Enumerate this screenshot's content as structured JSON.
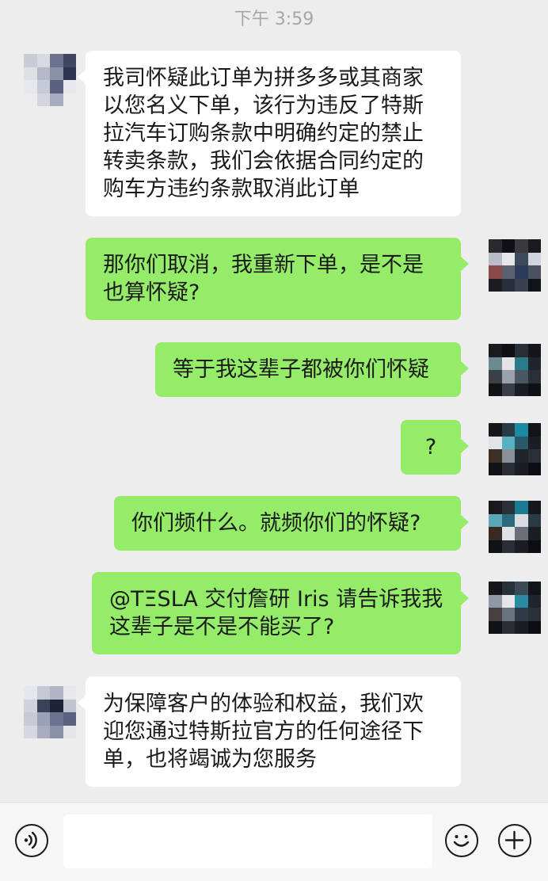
{
  "status": {
    "time": "下午 3:59"
  },
  "messages": [
    {
      "side": "in",
      "text": "我司怀疑此订单为拼多多或其商家以您名义下单，该行为违反了特斯拉汽车订购条款中明确约定的禁止转卖条款，我们会依据合同约定的购车方违约条款取消此订单"
    },
    {
      "side": "out",
      "text": "那你们取消，我重新下单，是不是也算怀疑?"
    },
    {
      "side": "out",
      "text": "等于我这辈子都被你们怀疑"
    },
    {
      "side": "out",
      "text": "?"
    },
    {
      "side": "out",
      "text": "你们频什么。就频你们的怀疑?"
    },
    {
      "side": "out",
      "text": "@TΞSLA 交付詹研 Iris 请告诉我我这辈子是不是不能买了?"
    },
    {
      "side": "in",
      "text": "为保障客户的体验和权益，我们欢迎您通过特斯拉官方的任何途径下单，也将竭诚为您服务"
    }
  ],
  "input_bar": {
    "voice_icon": "voice-icon",
    "emoji_icon": "emoji-icon",
    "plus_icon": "plus-icon",
    "input_value": ""
  },
  "colors": {
    "background": "#ededed",
    "outgoing_bubble": "#95ec69",
    "incoming_bubble": "#ffffff",
    "timestamp": "#a6a6a6"
  }
}
